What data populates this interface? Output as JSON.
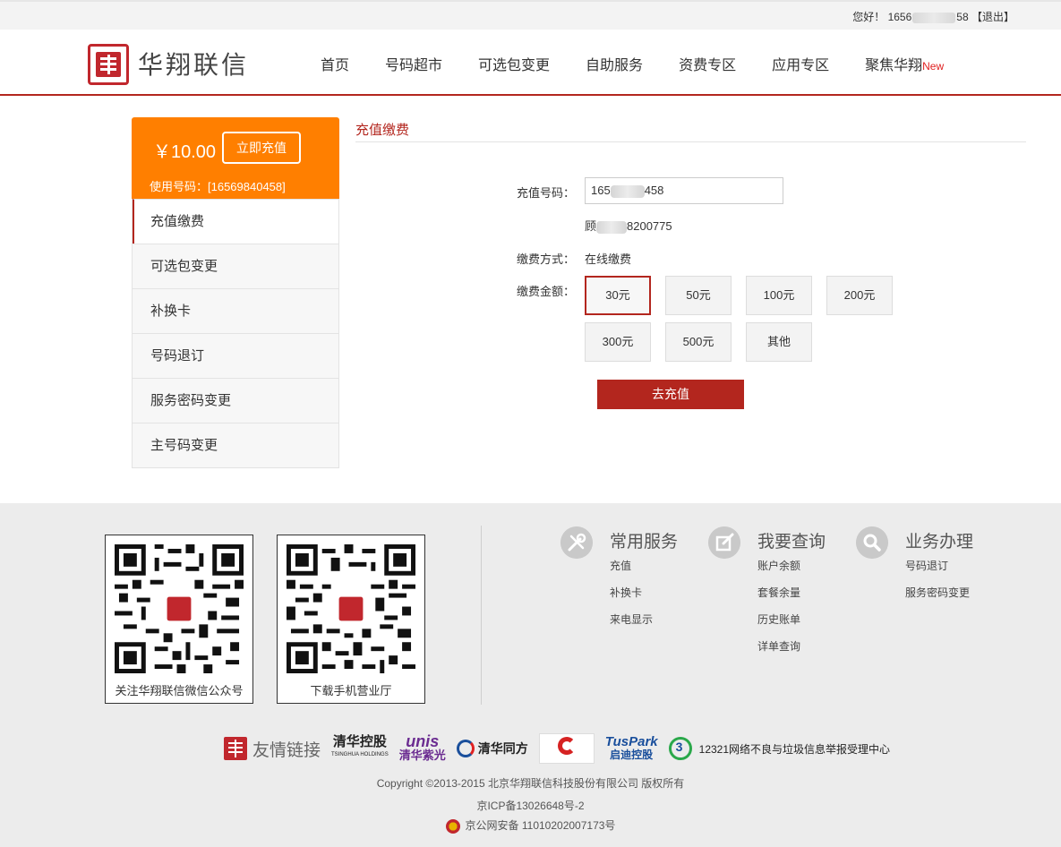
{
  "topbar": {
    "greeting": "您好！",
    "phone_prefix": "1656",
    "phone_suffix": "58",
    "logout": "【退出】"
  },
  "header": {
    "logo_text": "华翔联信",
    "nav": [
      {
        "label": "首页"
      },
      {
        "label": "号码超市"
      },
      {
        "label": "可选包变更"
      },
      {
        "label": "自助服务"
      },
      {
        "label": "资费专区"
      },
      {
        "label": "应用专区"
      },
      {
        "label": "聚焦华翔",
        "badge": "New"
      }
    ],
    "accent_color": "#b3261e"
  },
  "sidebar": {
    "balance": "￥10.00",
    "recharge_button": "立即充值",
    "phone_label": "使用号码：[16569840458]",
    "balance_bg": "#ff7f00",
    "menu": [
      {
        "label": "充值缴费",
        "active": true
      },
      {
        "label": "可选包变更"
      },
      {
        "label": "补换卡"
      },
      {
        "label": "号码退订"
      },
      {
        "label": "服务密码变更"
      },
      {
        "label": "主号码变更"
      }
    ]
  },
  "main": {
    "title": "充值缴费",
    "phone_label": "充值号码：",
    "phone_prefix": "165",
    "phone_suffix": "458",
    "owner_prefix": "顾",
    "owner_suffix": "8200775",
    "method_label": "缴费方式：",
    "method_value": "在线缴费",
    "amount_label": "缴费金额：",
    "amounts": [
      "30元",
      "50元",
      "100元",
      "200元",
      "300元",
      "500元",
      "其他"
    ],
    "selected_amount": "30元",
    "submit": "去充值"
  },
  "footer": {
    "qr_cards": [
      {
        "caption": "关注华翔联信微信公众号"
      },
      {
        "caption": "下载手机营业厅"
      }
    ],
    "columns": [
      {
        "heading": "常用服务",
        "icon": "tools-icon",
        "links": [
          "充值",
          "补换卡",
          "来电显示"
        ]
      },
      {
        "heading": "我要查询",
        "icon": "edit-icon",
        "links": [
          "账户余额",
          "套餐余量",
          "历史账单",
          "详单查询"
        ]
      },
      {
        "heading": "业务办理",
        "icon": "search-icon",
        "links": [
          "号码退订",
          "服务密码变更"
        ]
      }
    ],
    "partners": {
      "friend_links": "友情链接",
      "tsinghua": "清华控股",
      "tsinghua_en": "TSINGHUA HOLDINGS",
      "unis": "unis",
      "unis_cn": "清华紫光",
      "tongfang": "清华同方",
      "tuspark": "TusPark",
      "tuspark_cn": "启迪控股",
      "report": "12321网络不良与垃圾信息举报受理中心"
    },
    "copyright": "Copyright ©2013-2015 北京华翔联信科技股份有限公司 版权所有",
    "icp": "京ICP备13026648号-2",
    "police": "京公网安备 11010202007173号"
  }
}
